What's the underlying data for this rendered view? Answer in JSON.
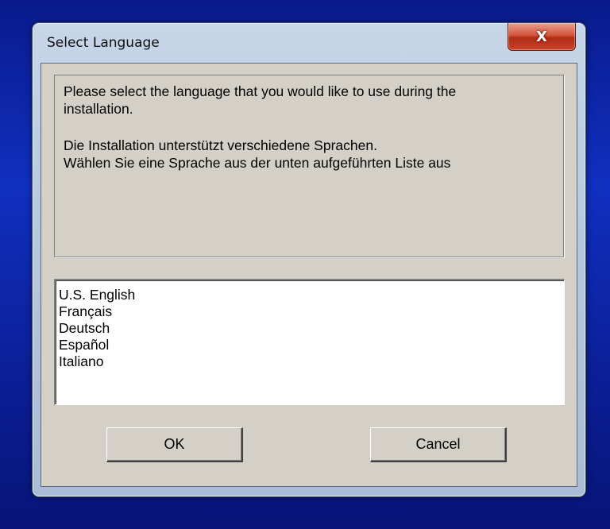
{
  "window": {
    "title": "Select Language",
    "close_glyph": "X"
  },
  "message": {
    "lines": [
      "Please select the language that you would like to use during the",
      "installation.",
      "Die Installation unterstützt verschiedene Sprachen.",
      "Wählen Sie eine Sprache aus der unten aufgeführten Liste aus"
    ]
  },
  "languages": [
    "U.S. English",
    "Français",
    "Deutsch",
    "Español",
    "Italiano"
  ],
  "buttons": {
    "ok": "OK",
    "cancel": "Cancel"
  }
}
